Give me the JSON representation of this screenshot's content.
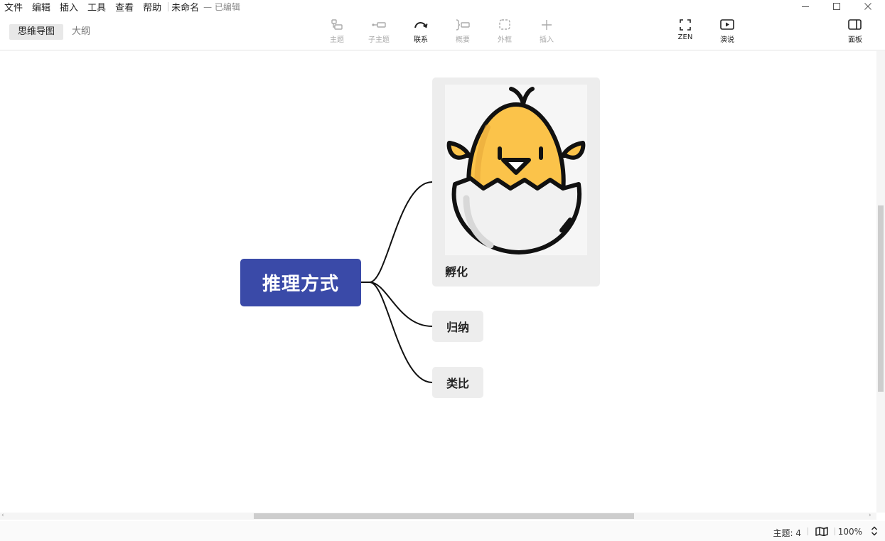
{
  "menubar": {
    "items": [
      "文件",
      "编辑",
      "插入",
      "工具",
      "查看",
      "帮助"
    ],
    "doc_title": "未命名",
    "doc_status": "— 已编辑"
  },
  "view_tabs": [
    {
      "label": "思维导图",
      "active": true
    },
    {
      "label": "大纲",
      "active": false
    }
  ],
  "toolbar": {
    "topic": "主题",
    "subtopic": "子主题",
    "relationship": "联系",
    "summary": "概要",
    "boundary": "外框",
    "insert": "插入",
    "zen": "ZEN",
    "pitch": "演说",
    "panel": "面板"
  },
  "mindmap": {
    "root": "推理方式",
    "children": [
      {
        "label": "孵化",
        "image": "hatching-chick-icon"
      },
      {
        "label": "归纳"
      },
      {
        "label": "类比"
      }
    ]
  },
  "status": {
    "topics": "主题: 4",
    "zoom": "100%"
  },
  "colors": {
    "root_fill": "#3a4aa8",
    "node_fill": "#ededed",
    "chick_yellow": "#fbc34a"
  }
}
